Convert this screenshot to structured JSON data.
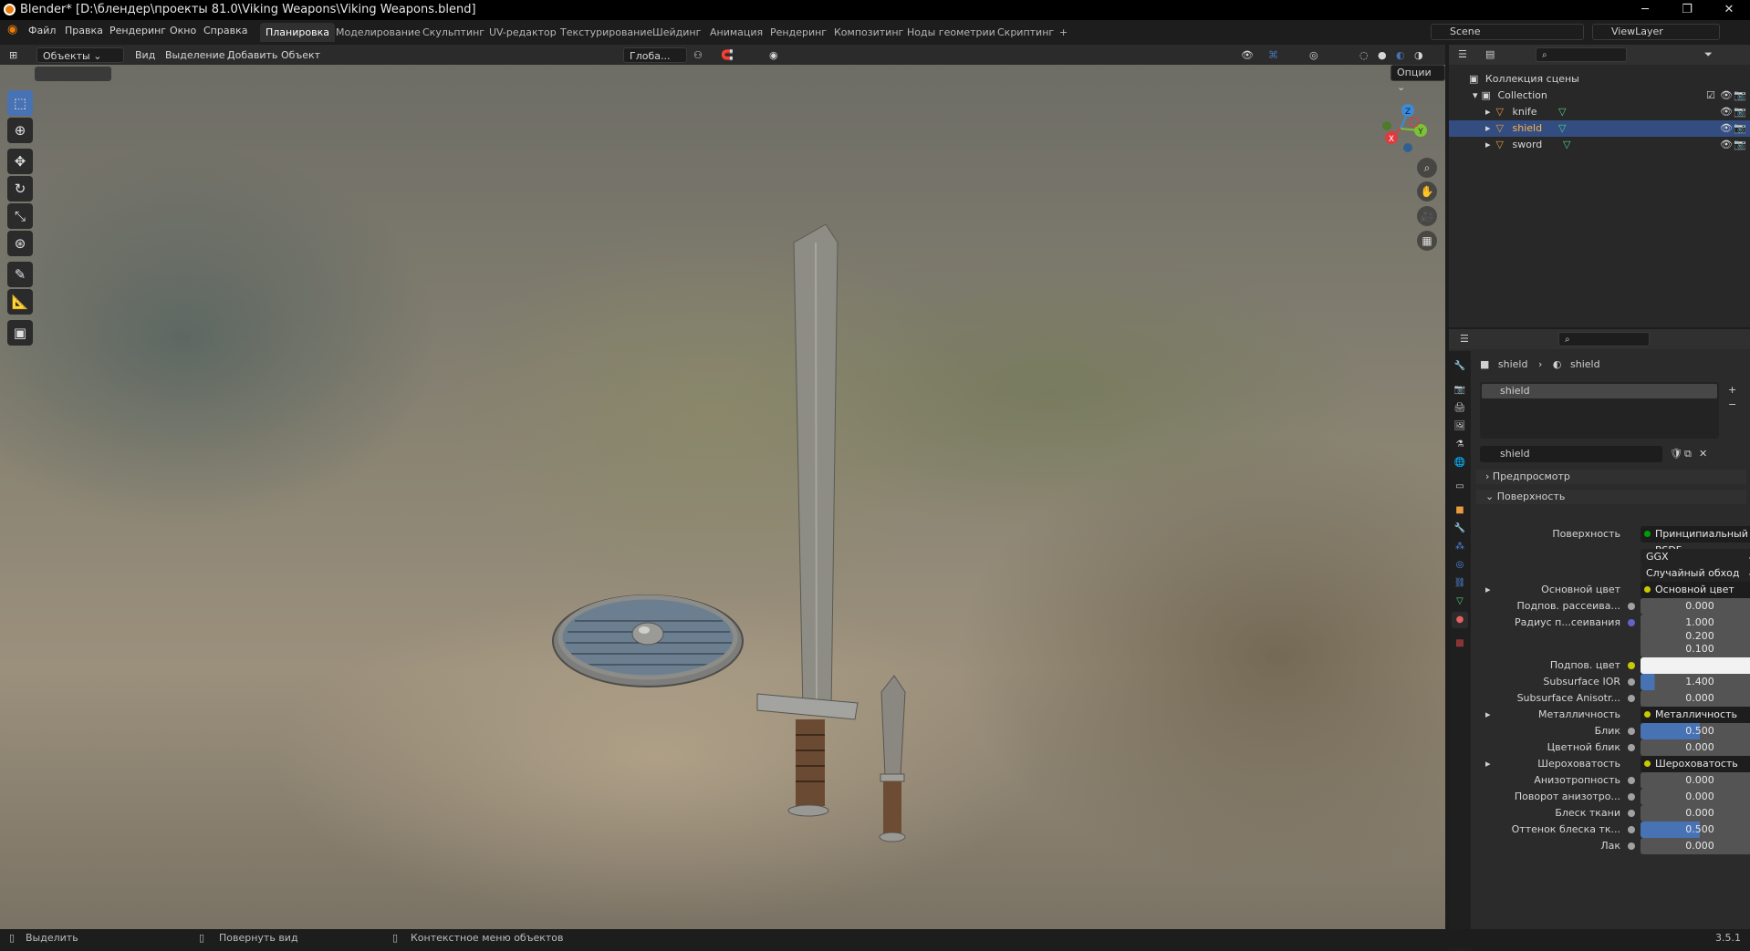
{
  "window": {
    "title": "Blender* [D:\\блендер\\проекты 81.0\\Viking Weapons\\Viking Weapons.blend]",
    "minimize": "─",
    "maximize": "❐",
    "close": "✕"
  },
  "menu": [
    "Файл",
    "Правка",
    "Рендеринг",
    "Окно",
    "Справка"
  ],
  "workspaces": [
    "Планировка",
    "Моделирование",
    "Скульптинг",
    "UV-редактор",
    "Текстурирование",
    "Шейдинг",
    "Анимация",
    "Рендеринг",
    "Композитинг",
    "Ноды геометрии",
    "Скриптинг",
    "+"
  ],
  "scene": {
    "name": "Scene",
    "viewlayer": "ViewLayer"
  },
  "header": {
    "mode": "Объекты",
    "view": "Вид",
    "select": "Выделение",
    "add": "Добавить",
    "object": "Объект",
    "transform": "Глоба...",
    "options": "Опции"
  },
  "gizmo": {
    "x": "X",
    "y": "Y",
    "z": "Z"
  },
  "outliner": {
    "root": "Коллекция сцены",
    "collection": "Collection",
    "items": [
      {
        "name": "knife"
      },
      {
        "name": "shield"
      },
      {
        "name": "sword"
      }
    ]
  },
  "props": {
    "breadcrumb_obj": "shield",
    "breadcrumb_mat": "shield",
    "slot": "shield",
    "material": "shield",
    "preview": "Предпросмотр",
    "surface_panel": "Поверхность",
    "rows": [
      {
        "label": "Поверхность",
        "value": "Принципиальный BSDF",
        "kind": "node"
      },
      {
        "label": "",
        "value": "GGX",
        "kind": "enum"
      },
      {
        "label": "",
        "value": "Случайный обход",
        "kind": "enum"
      },
      {
        "label": "Основной цвет",
        "value": "Основной цвет",
        "kind": "node"
      },
      {
        "label": "Подпов. рассеива...",
        "value": "0.000",
        "kind": "num"
      },
      {
        "label": "Радиус п...сеивания",
        "value": "1.000",
        "kind": "num"
      },
      {
        "label": "",
        "value": "0.200",
        "kind": "num"
      },
      {
        "label": "",
        "value": "0.100",
        "kind": "num"
      },
      {
        "label": "Подпов. цвет",
        "value": "",
        "kind": "color"
      },
      {
        "label": "Subsurface IOR",
        "value": "1.400",
        "kind": "bar"
      },
      {
        "label": "Subsurface Anisotr...",
        "value": "0.000",
        "kind": "num"
      },
      {
        "label": "Металличность",
        "value": "Металличность",
        "kind": "node"
      },
      {
        "label": "Блик",
        "value": "0.500",
        "kind": "bar"
      },
      {
        "label": "Цветной блик",
        "value": "0.000",
        "kind": "num"
      },
      {
        "label": "Шероховатость",
        "value": "Шероховатость",
        "kind": "node"
      },
      {
        "label": "Анизотропность",
        "value": "0.000",
        "kind": "num"
      },
      {
        "label": "Поворот анизотро...",
        "value": "0.000",
        "kind": "num"
      },
      {
        "label": "Блеск ткани",
        "value": "0.000",
        "kind": "num"
      },
      {
        "label": "Оттенок блеска тк...",
        "value": "0.500",
        "kind": "bar"
      },
      {
        "label": "Лак",
        "value": "0.000",
        "kind": "num"
      }
    ]
  },
  "status": {
    "select": "Выделить",
    "rotate": "Повернуть вид",
    "context": "Контекстное меню объектов",
    "version": "3.5.1"
  },
  "icons": [
    "blender-icon",
    "select-box-icon",
    "cursor-icon",
    "move-icon",
    "rotate-icon",
    "scale-icon",
    "transform-icon",
    "annotate-icon",
    "measure-icon",
    "add-cube-icon",
    "zoom-icon",
    "pan-hand-icon",
    "camera-icon",
    "grid-icon",
    "eye-icon",
    "camera-render-icon",
    "filter-icon",
    "mesh-data-icon",
    "material-icon"
  ],
  "colors": {
    "accent": "#4772b3",
    "selected_row": "#334d80",
    "x_axis": "#e0393e",
    "y_axis": "#7cc236",
    "z_axis": "#3a8bd9"
  }
}
